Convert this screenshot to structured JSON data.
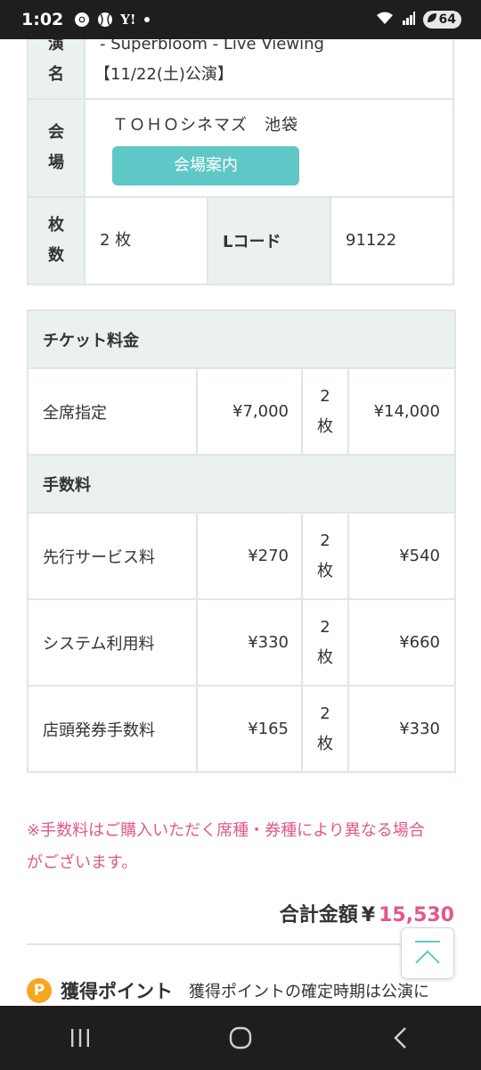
{
  "status_bar": {
    "time": "1:02",
    "icons": [
      "chrome-icon",
      "baseball-icon",
      "yahoo-icon",
      "dot-icon"
    ],
    "yahoo_text": "Y!",
    "battery": "64"
  },
  "event_info": {
    "title_header": [
      "演",
      "名"
    ],
    "title_lines": [
      "- Superbloom - Live Viewing",
      "【11/22(土)公演】"
    ],
    "venue_header": [
      "会",
      "場"
    ],
    "venue_name": "ＴＯＨＯシネマズ　池袋",
    "venue_button": "会場案内",
    "count_header": [
      "枚",
      "数"
    ],
    "count_value": "2 枚",
    "lcode_label": "Lコード",
    "lcode_value": "91122"
  },
  "fees": {
    "ticket_section": "チケット料金",
    "ticket_rows": [
      {
        "name": "全席指定",
        "price": "¥7,000",
        "qty": "2",
        "unit": "枚",
        "subtotal": "¥14,000"
      }
    ],
    "fee_section": "手数料",
    "fee_rows": [
      {
        "name": "先行サービス料",
        "price": "¥270",
        "qty": "2",
        "unit": "枚",
        "subtotal": "¥540"
      },
      {
        "name": "システム利用料",
        "price": "¥330",
        "qty": "2",
        "unit": "枚",
        "subtotal": "¥660"
      },
      {
        "name": "店頭発券手数料",
        "price": "¥165",
        "qty": "2",
        "unit": "枚",
        "subtotal": "¥330"
      }
    ]
  },
  "note": {
    "line1": "※手数料はご購入いただく席種・券種により異なる場合",
    "line2": "がございます。"
  },
  "total": {
    "label": "合計金額",
    "currency": "¥",
    "amount": "15,530"
  },
  "points": {
    "badge": "P",
    "title": "獲得ポイント",
    "text": "獲得ポイントの確定時期は公演に"
  },
  "colors": {
    "accent_teal": "#5fc7c6",
    "accent_pink": "#e0588a",
    "header_bg": "#ebf0f0",
    "coin": "#f5a623"
  }
}
